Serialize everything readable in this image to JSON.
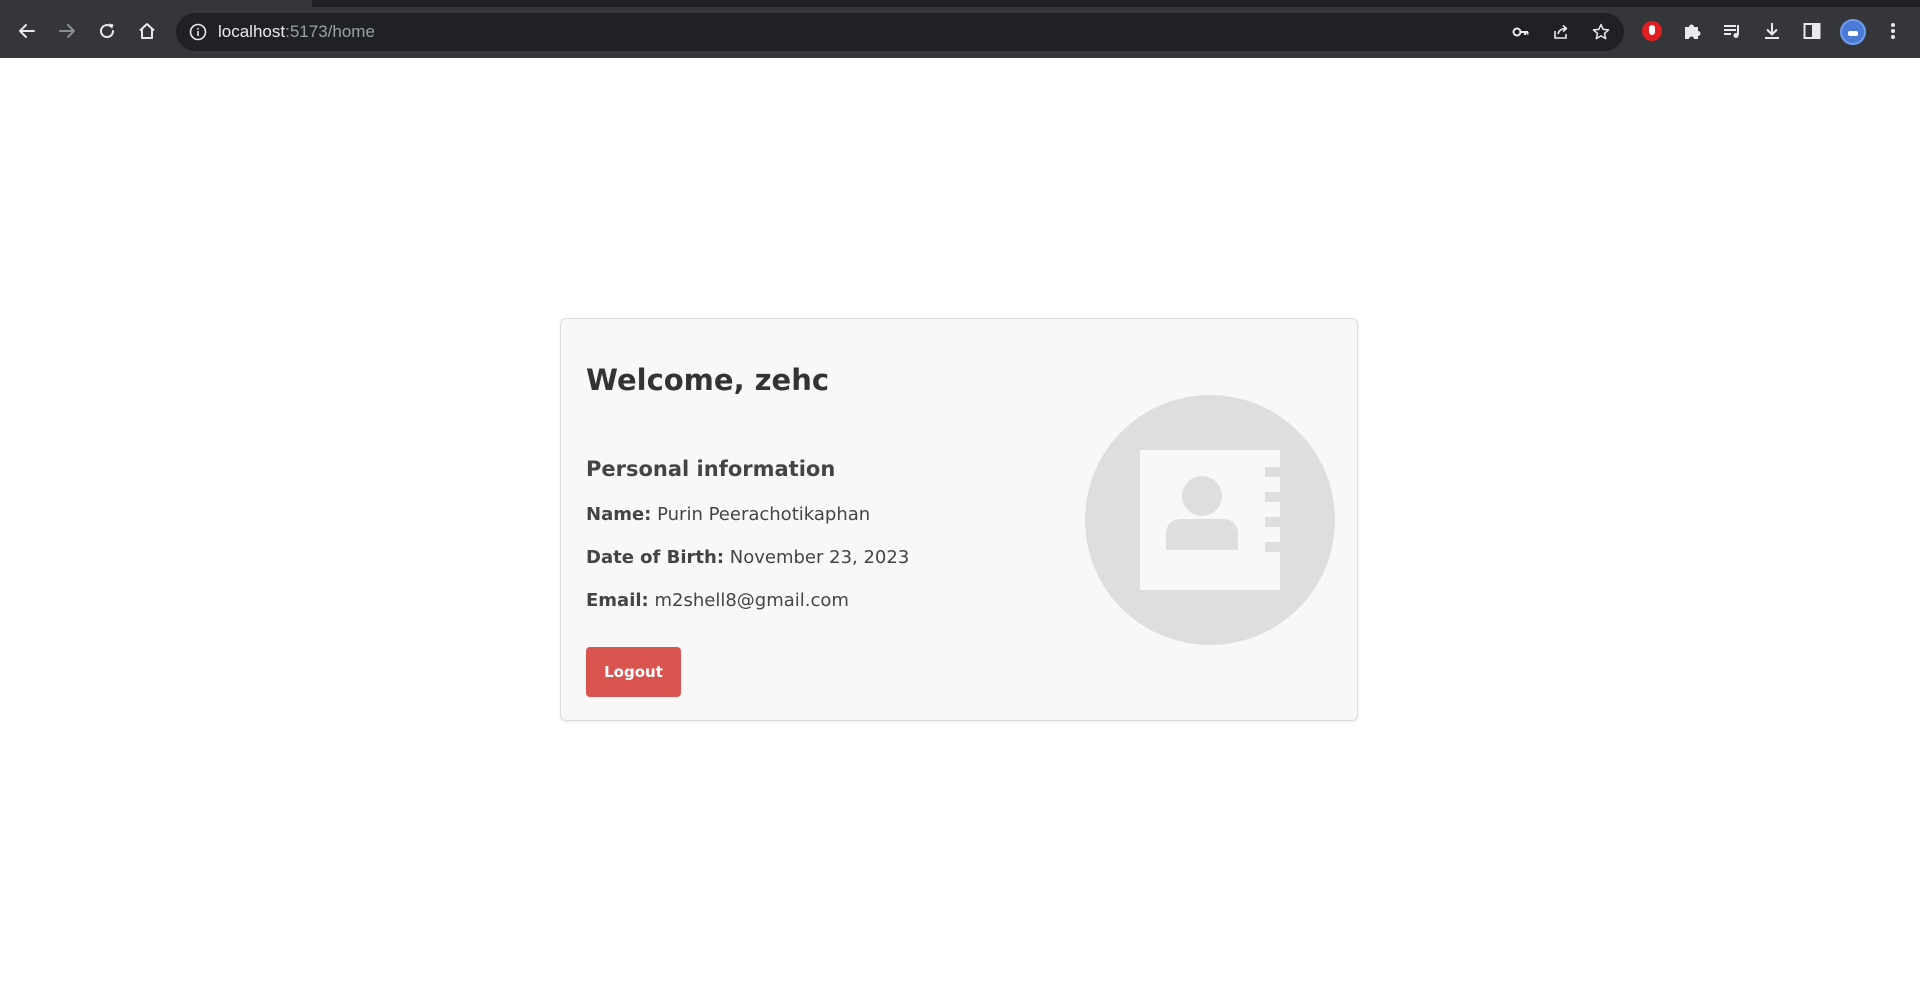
{
  "browser": {
    "url_host": "localhost",
    "url_path": ":5173/home",
    "icons": {
      "back": "back-arrow-icon",
      "forward": "forward-arrow-icon",
      "reload": "reload-icon",
      "home": "home-icon",
      "site_info": "info-icon",
      "password": "key-icon",
      "share": "share-icon",
      "bookmark": "star-icon",
      "extension_red": "hand-stop-icon",
      "extensions": "puzzle-icon",
      "reading_list": "media-queue-icon",
      "downloads": "download-icon",
      "side_panel": "side-panel-icon",
      "profile": "avatar",
      "menu": "kebab-menu-icon"
    }
  },
  "card": {
    "welcome": "Welcome, zehc",
    "section_title": "Personal information",
    "name_label": "Name:",
    "name_value": "Purin Peerachotikaphan",
    "dob_label": "Date of Birth:",
    "dob_value": "November 23, 2023",
    "email_label": "Email:",
    "email_value": "m2shell8@gmail.com",
    "logout_label": "Logout",
    "profile_icon": "contact-book-icon"
  },
  "colors": {
    "logout_button": "#d9534f",
    "card_background": "#f8f8f8",
    "browser_chrome": "#35363a",
    "omnibox": "#202124"
  }
}
